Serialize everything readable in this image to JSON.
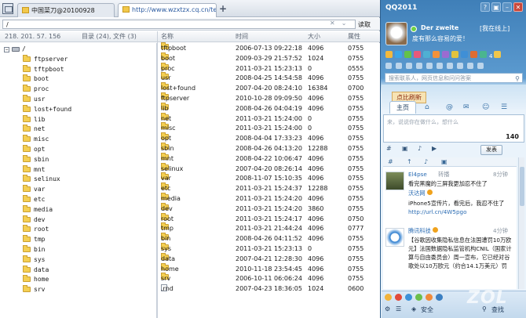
{
  "ftp": {
    "tabs": [
      {
        "label": "中国菜刀@20100928",
        "active": false
      },
      {
        "label": "http://www.wzxtzx.cq.cn/tem…",
        "active": true
      }
    ],
    "new_tab": "+",
    "address": "/",
    "read_button": "读取",
    "header": {
      "ip": "218. 201. 57. 156",
      "summary": "目录 (24), 文件 (3)",
      "col_name": "名称",
      "col_time": "时间",
      "col_size": "大小",
      "col_attr": "属性"
    },
    "tree_root": "/",
    "tree": [
      "ftpserver",
      "tftpboot",
      "boot",
      "proc",
      "usr",
      "lost+found",
      "lib",
      "net",
      "misc",
      "opt",
      "sbin",
      "mnt",
      "selinux",
      "var",
      "etc",
      "media",
      "dev",
      "root",
      "tmp",
      "bin",
      "sys",
      "data",
      "home",
      "srv"
    ],
    "files": [
      {
        "name": "tftpboot",
        "time": "2006-07-13 09:22:18",
        "size": "4096",
        "attr": "0755",
        "type": "folder"
      },
      {
        "name": "boot",
        "time": "2009-03-29 21:57:52",
        "size": "1024",
        "attr": "0755",
        "type": "folder"
      },
      {
        "name": "proc",
        "time": "2011-03-21 15:23:13",
        "size": "0",
        "attr": "0555",
        "type": "folder"
      },
      {
        "name": "usr",
        "time": "2008-04-25 14:54:58",
        "size": "4096",
        "attr": "0755",
        "type": "folder"
      },
      {
        "name": "lost+found",
        "time": "2007-04-20 08:24:10",
        "size": "16384",
        "attr": "0700",
        "type": "folder"
      },
      {
        "name": "ftpserver",
        "time": "2010-10-28 09:09:50",
        "size": "4096",
        "attr": "0755",
        "type": "folder"
      },
      {
        "name": "lib",
        "time": "2008-04-26 04:04:19",
        "size": "4096",
        "attr": "0755",
        "type": "folder"
      },
      {
        "name": "net",
        "time": "2011-03-21 15:24:00",
        "size": "0",
        "attr": "0755",
        "type": "folder"
      },
      {
        "name": "misc",
        "time": "2011-03-21 15:24:00",
        "size": "0",
        "attr": "0755",
        "type": "folder"
      },
      {
        "name": "opt",
        "time": "2008-04-04 17:33:23",
        "size": "4096",
        "attr": "0755",
        "type": "folder"
      },
      {
        "name": "sbin",
        "time": "2008-04-26 04:13:20",
        "size": "12288",
        "attr": "0755",
        "type": "folder"
      },
      {
        "name": "mnt",
        "time": "2008-04-22 10:06:47",
        "size": "4096",
        "attr": "0755",
        "type": "folder"
      },
      {
        "name": "selinux",
        "time": "2007-04-20 08:26:14",
        "size": "4096",
        "attr": "0755",
        "type": "folder"
      },
      {
        "name": "var",
        "time": "2008-11-07 15:10:35",
        "size": "4096",
        "attr": "0755",
        "type": "folder"
      },
      {
        "name": "etc",
        "time": "2011-03-21 15:24:37",
        "size": "12288",
        "attr": "0755",
        "type": "folder"
      },
      {
        "name": "media",
        "time": "2011-03-21 15:24:20",
        "size": "4096",
        "attr": "0755",
        "type": "folder"
      },
      {
        "name": "dev",
        "time": "2011-03-21 15:24:20",
        "size": "3860",
        "attr": "0755",
        "type": "folder"
      },
      {
        "name": "root",
        "time": "2011-03-21 15:24:17",
        "size": "4096",
        "attr": "0750",
        "type": "folder"
      },
      {
        "name": "tmp",
        "time": "2011-03-21 21:44:24",
        "size": "4096",
        "attr": "0777",
        "type": "folder"
      },
      {
        "name": "bin",
        "time": "2008-04-26 04:11:52",
        "size": "4096",
        "attr": "0755",
        "type": "folder"
      },
      {
        "name": "sys",
        "time": "2011-03-21 15:23:13",
        "size": "0",
        "attr": "0755",
        "type": "folder"
      },
      {
        "name": "data",
        "time": "2007-04-21 12:28:30",
        "size": "4096",
        "attr": "0755",
        "type": "folder"
      },
      {
        "name": "home",
        "time": "2010-11-18 23:54:45",
        "size": "4096",
        "attr": "0755",
        "type": "folder"
      },
      {
        "name": "srv",
        "time": "2006-10-11 06:06:24",
        "size": "4096",
        "attr": "0755",
        "type": "folder"
      },
      {
        "name": ".rnd",
        "time": "2007-04-23 18:36:05",
        "size": "1024",
        "attr": "0600",
        "type": "file"
      }
    ]
  },
  "qq": {
    "title": "QQ2011",
    "nickname": "Der zweite",
    "status": "[我在线上]",
    "motto": "度有那么容易的爱！",
    "unread_count": "4",
    "search_placeholder": "搜索联系人，网页信息和问问答案",
    "ad_label": "点比刷新",
    "tab_main": "主页",
    "compose_placeholder": "来，说说你在做什么，想什么",
    "char_count": "140",
    "send_label": "发表",
    "feed_tabs": [
      "#",
      "↑",
      "♪",
      "▣"
    ],
    "posts": [
      {
        "name": "El4pse",
        "meta": "转播",
        "time": "8分钟",
        "text": "看完黑魔的三屏我更加忍不住了"
      },
      {
        "name": "沃达网",
        "time": "",
        "text": "iPhone5宣传片，看完后，我忍不住了",
        "link": "http://url.cn/4W5pgo"
      },
      {
        "name": "腾讯科技",
        "time": "4分钟",
        "text": "【谷歌因收集隐私信息在法国遭罚10万欧元】法国数据隐私监管机构CNIL（国家计算与自由委员会）周一宣布，它已经对谷歌处以10万欧元（约合14.1万美元）罚"
      }
    ],
    "bottom": {
      "security_label": "安全",
      "search_label": "查找"
    },
    "watermark": "ZOL"
  }
}
